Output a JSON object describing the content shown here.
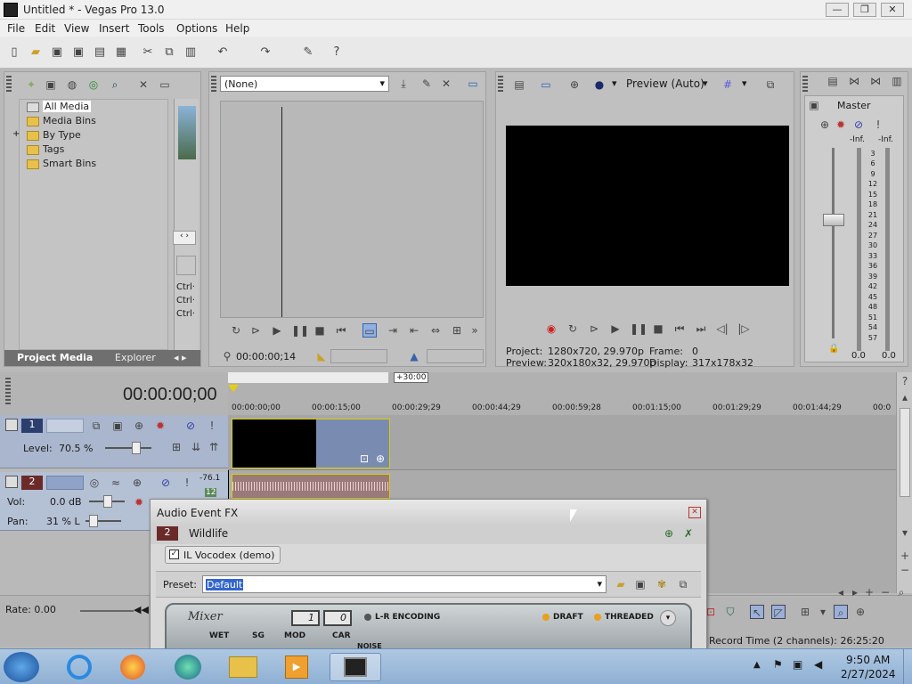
{
  "window": {
    "title": "Untitled * - Vegas Pro 13.0",
    "btn_min": "—",
    "btn_max": "❐",
    "btn_close": "✕"
  },
  "menu": [
    "File",
    "Edit",
    "View",
    "Insert",
    "Tools",
    "Options",
    "Help"
  ],
  "project_media": {
    "tree": [
      "All Media",
      "Media Bins",
      "By Type",
      "Tags",
      "Smart Bins"
    ],
    "expand": "+",
    "tabs": [
      "Project Media",
      "Explorer"
    ],
    "side_labels": [
      "Ctrl·",
      "Ctrl·",
      "Ctrl·"
    ]
  },
  "trimmer": {
    "dropdown": "(None)",
    "timecode": "00:00:00;14"
  },
  "preview": {
    "mode": "Preview (Auto)",
    "project_label": "Project:",
    "project_value": "1280x720, 29.970p",
    "preview_label": "Preview:",
    "preview_value": "320x180x32, 29.970p",
    "frame_label": "Frame:",
    "frame_value": "0",
    "display_label": "Display:",
    "display_value": "317x178x32"
  },
  "master": {
    "label": "Master",
    "inf_l": "-Inf.",
    "inf_r": "-Inf.",
    "scale": [
      "3",
      "6",
      "9",
      "12",
      "15",
      "18",
      "21",
      "24",
      "27",
      "30",
      "33",
      "36",
      "39",
      "42",
      "45",
      "48",
      "51",
      "54",
      "57"
    ],
    "val_l": "0.0",
    "val_r": "0.0"
  },
  "timeline": {
    "timecode": "00:00:00;00",
    "marker": "+30:00",
    "ruler": [
      "00:00:00;00",
      "00:00:15;00",
      "00:00:29;29",
      "00:00:44;29",
      "00:00:59;28",
      "00:01:15;00",
      "00:01:29;29",
      "00:01:44;29",
      "00:0"
    ],
    "track1": {
      "num": "1",
      "level_label": "Level:",
      "level_value": "70.5 %"
    },
    "track2": {
      "num": "2",
      "vol_label": "Vol:",
      "vol_value": "0.0 dB",
      "pan_label": "Pan:",
      "pan_value": "31 % L",
      "meter_top": "-76.1",
      "meter_bot": "12"
    },
    "rate": "Rate: 0.00",
    "record_time": "Record Time (2 channels): 26:25:20"
  },
  "fx_dialog": {
    "title": "Audio Event FX",
    "track_num": "2",
    "event_name": "Wildlife",
    "plugin": "IL Vocodex (demo)",
    "preset_label": "Preset:",
    "preset_value": "Default",
    "plugin_ui": {
      "brand": "Mixer",
      "lr": "L-R ENCODING",
      "draft": "DRAFT",
      "threaded": "THREADED",
      "wet": "WET",
      "sg": "SG",
      "mod": "MOD",
      "car": "CAR",
      "noise": "NOISE",
      "d1": "1",
      "d2": "0"
    }
  },
  "taskbar": {
    "time": "9:50 AM",
    "date": "2/27/2024"
  }
}
